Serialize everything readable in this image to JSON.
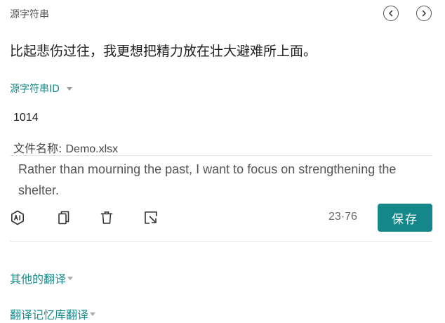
{
  "header": {
    "source_label": "源字符串",
    "prev_icon": "chevron-left-circle-icon",
    "next_icon": "chevron-right-circle-icon"
  },
  "source_text": "比起悲伤过往，我更想把精力放在壮大避难所上面。",
  "string_id": {
    "label": "源字符串ID",
    "value": "1014"
  },
  "file": {
    "label": "文件名称:",
    "value": "Demo.xlsx"
  },
  "translation": {
    "value": "Rather than mourning the past, I want to focus on strengthening the shelter."
  },
  "toolbar": {
    "ai_icon": "ai-icon",
    "copy_icon": "copy-icon",
    "delete_icon": "trash-icon",
    "open_icon": "external-link-icon",
    "counter": "23·76",
    "save_label": "保存"
  },
  "sections": {
    "other_translations": "其他的翻译",
    "tm_translations": "翻译记忆库翻译"
  },
  "colors": {
    "accent": "#13878a",
    "link": "#1a8a8a"
  }
}
